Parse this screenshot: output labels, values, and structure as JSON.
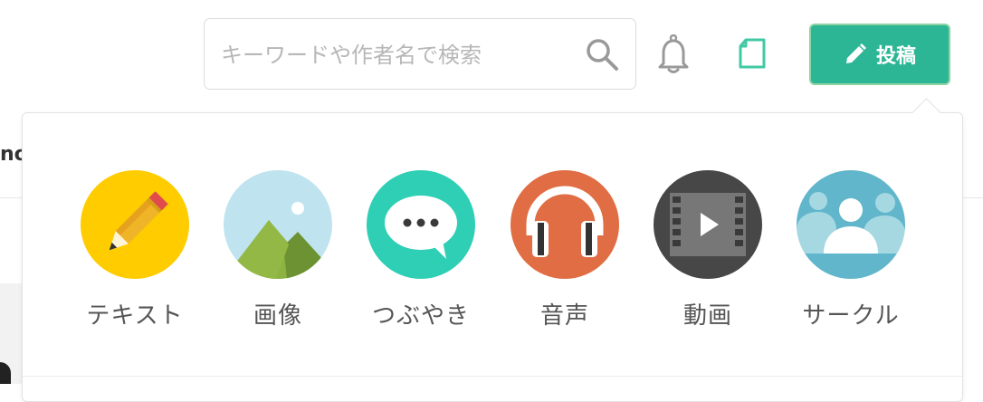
{
  "search": {
    "placeholder": "キーワードや作者名で検索",
    "value": ""
  },
  "header": {
    "post_label": "投稿"
  },
  "background": {
    "partial_text": "no"
  },
  "menu": {
    "items": [
      {
        "label": "テキスト",
        "icon": "pencil-icon",
        "color": "#ffcc00"
      },
      {
        "label": "画像",
        "icon": "image-icon",
        "color": "#bfe4ef"
      },
      {
        "label": "つぶやき",
        "icon": "speech-bubble-icon",
        "color": "#2ecfb5"
      },
      {
        "label": "音声",
        "icon": "headphones-icon",
        "color": "#e06d43"
      },
      {
        "label": "動画",
        "icon": "film-icon",
        "color": "#474747"
      },
      {
        "label": "サークル",
        "icon": "people-icon",
        "color": "#61b6cb"
      }
    ]
  },
  "colors": {
    "accent": "#2cb696",
    "accent_border": "#8dd3a4",
    "note_icon": "#41c9a6",
    "icon_gray": "#999999"
  }
}
